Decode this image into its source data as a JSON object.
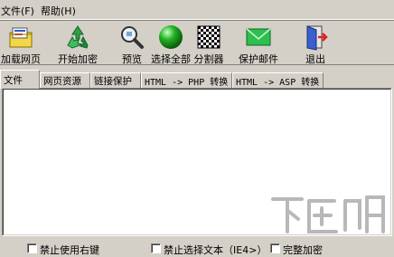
{
  "menu": {
    "items": [
      "文件(F)",
      "帮助(H)"
    ]
  },
  "toolbar": {
    "buttons": [
      {
        "label": "加载网页",
        "icon": "load-page-icon"
      },
      {
        "label": "开始加密",
        "icon": "recycle-icon"
      },
      {
        "label": "预览",
        "icon": "magnifier-icon"
      },
      {
        "label": "选择全部",
        "icon": "green-sphere-icon"
      },
      {
        "label": "分割器",
        "icon": "checkerboard-icon"
      },
      {
        "label": "保护邮件",
        "icon": "envelope-icon"
      },
      {
        "label": "退出",
        "icon": "exit-door-icon"
      }
    ]
  },
  "tabs": [
    "文件",
    "网页资源",
    "链接保护",
    "HTML -> PHP 转换",
    "HTML -> ASP 转换"
  ],
  "editor": {
    "content": ""
  },
  "statusbar": {
    "checkboxes": [
      "禁止使用右键",
      "禁止选择文本（IE4>）",
      "完整加密"
    ]
  },
  "watermark": {
    "text": "下载吧",
    "icon": "watermark-logo"
  },
  "colors": {
    "window": "#d4d0c8",
    "editor_bg": "#ffffff",
    "watermark": "#b8b8b8"
  }
}
